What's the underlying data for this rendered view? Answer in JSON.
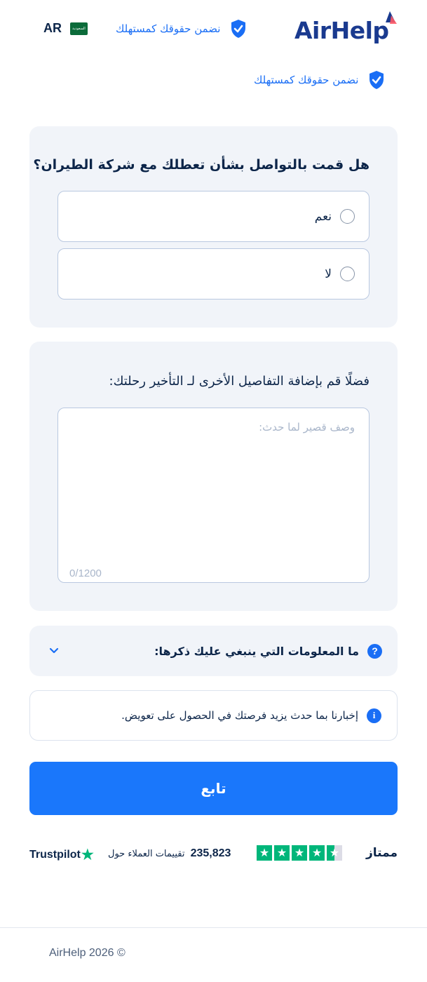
{
  "header": {
    "logo_text": "AirHelp",
    "guarantee_text": "نضمن حقوقك كمستهلك",
    "lang_code": "AR",
    "flag_text": "السعودية"
  },
  "subheader": {
    "guarantee_text": "نضمن حقوقك كمستهلك"
  },
  "contact_card": {
    "question": "هل قمت بالتواصل بشأن تعطلك مع شركة الطيران؟",
    "options": [
      {
        "label": "نعم",
        "selected": false
      },
      {
        "label": "لا",
        "selected": false
      }
    ]
  },
  "details_card": {
    "title": "فضلًا قم بإضافة التفاصيل الأخرى لـ التأخير رحلتك:",
    "placeholder": "وصف قصير لما حدث:",
    "value": "",
    "counter": "0/1200"
  },
  "faq": {
    "question": "ما المعلومات التي ينبغي عليك ذكرها:",
    "icon_text": "?"
  },
  "info": {
    "icon_text": "i",
    "text": "إخبارنا بما حدث يزيد فرصتك في الحصول على تعويض."
  },
  "continue_button": {
    "label": "تابع"
  },
  "trustpilot": {
    "rating_word": "ممتاز",
    "rating": 4.5,
    "review_count": "235,823",
    "review_text": "تقييمات العملاء حول",
    "brand": "Trustpilot"
  },
  "footer": {
    "copyright": "AirHelp 2026 ©"
  },
  "colors": {
    "primary": "#1a77fb",
    "navy": "#0c2549",
    "card_bg": "#f1f4f9",
    "trust_green": "#00b67a"
  }
}
